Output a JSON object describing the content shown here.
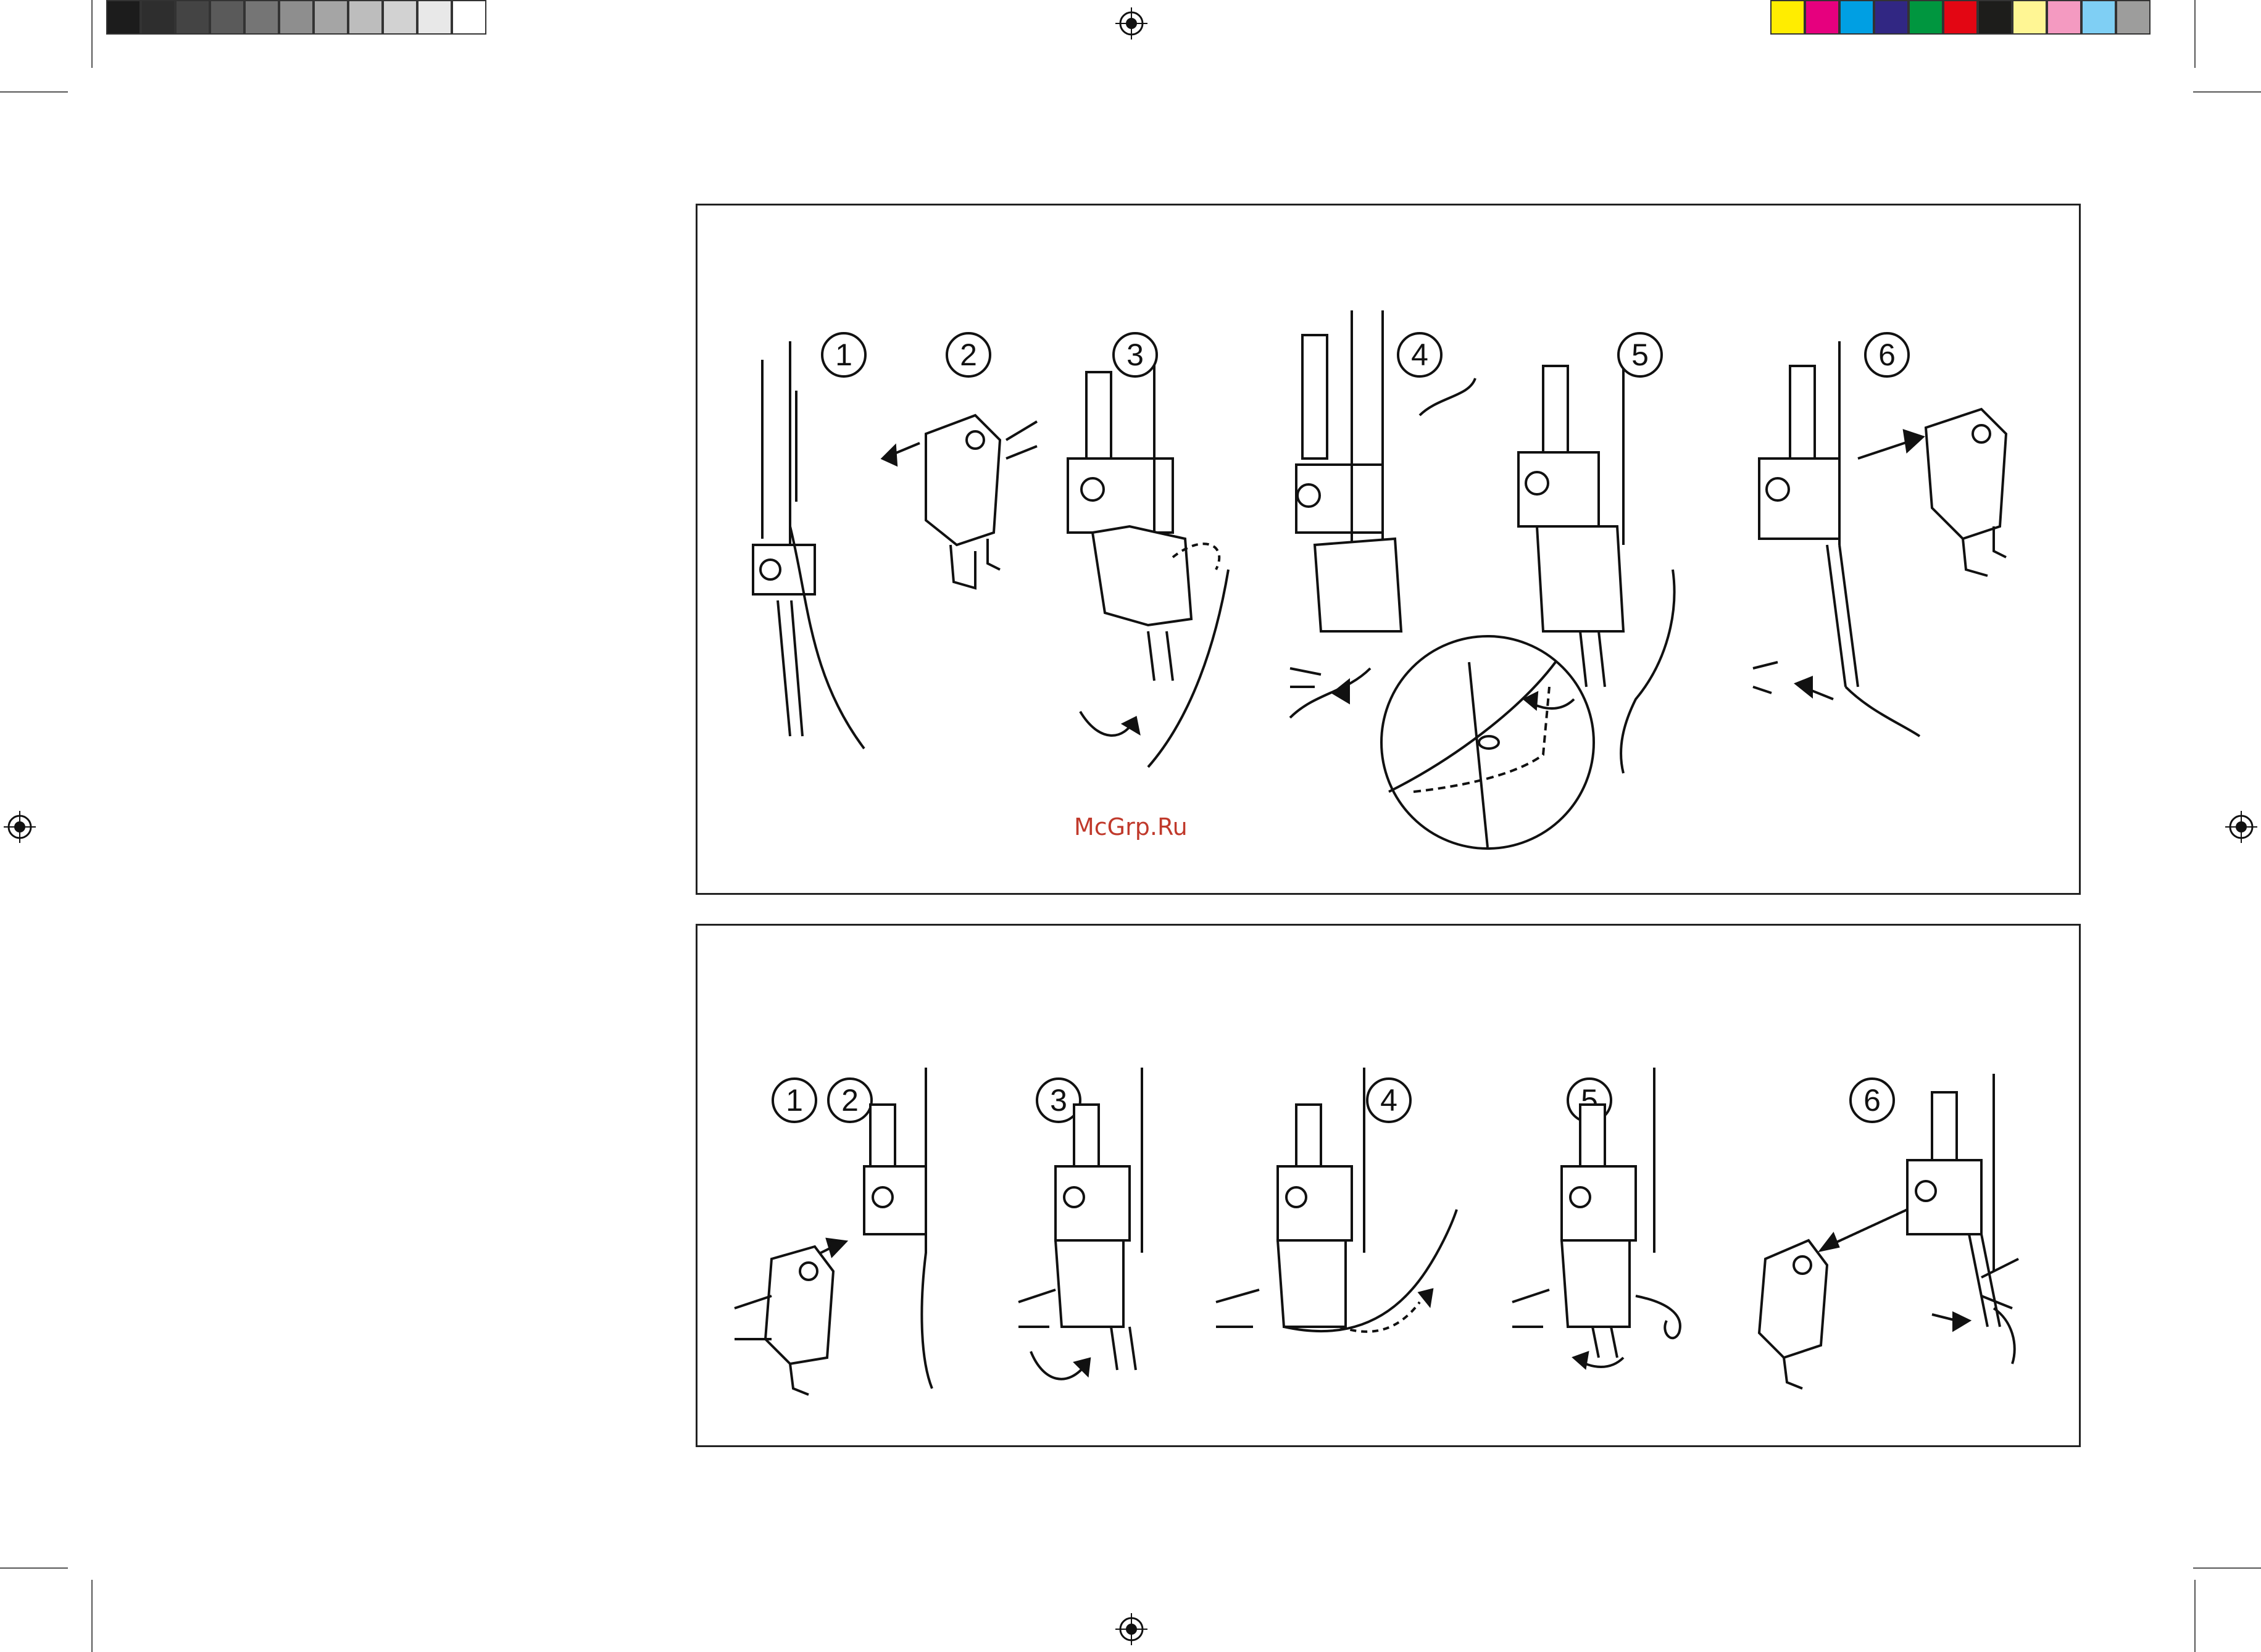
{
  "color_bar": {
    "grays": [
      "#1c1c1c",
      "#2e2e2e",
      "#444444",
      "#5a5a5a",
      "#757575",
      "#8e8e8e",
      "#a5a5a5",
      "#bdbdbd",
      "#d2d2d2",
      "#e8e8e8",
      "#ffffff"
    ],
    "colors": [
      "#ffed00",
      "#e6007e",
      "#009fe3",
      "#312783",
      "#00963f",
      "#e30613",
      "#1d1d1b",
      "#fff694",
      "#f49ac1",
      "#7fcff4",
      "#9d9d9c"
    ]
  },
  "watermark": "McGrp.Ru",
  "panel_top": {
    "steps": [
      "1",
      "2",
      "3",
      "4",
      "5",
      "6"
    ]
  },
  "panel_bottom": {
    "steps": [
      "1",
      "2",
      "3",
      "4",
      "5",
      "6"
    ]
  }
}
